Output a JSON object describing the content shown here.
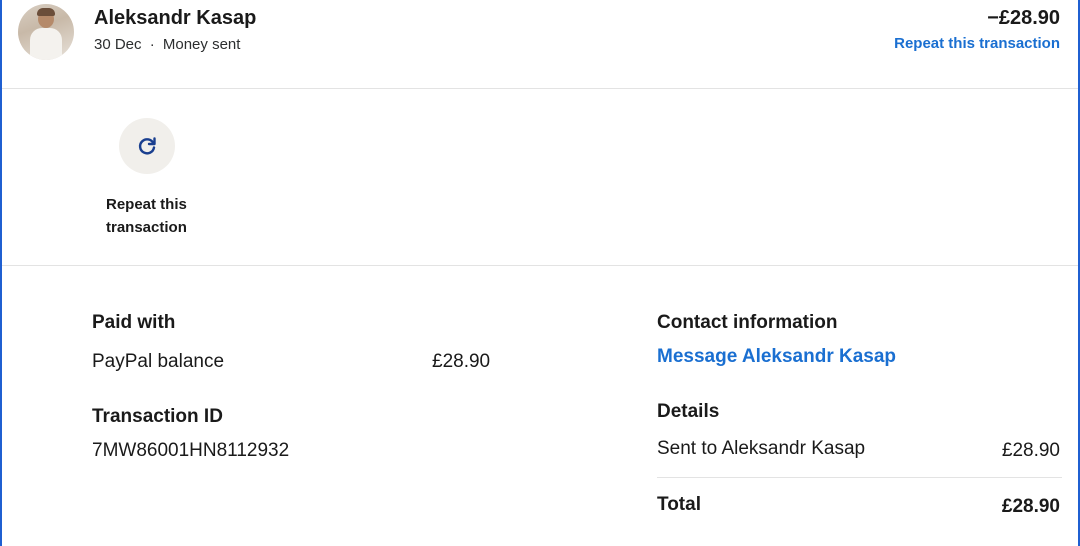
{
  "header": {
    "name": "Aleksandr Kasap",
    "date": "30 Dec",
    "separator": "·",
    "type": "Money sent",
    "amount": "−£28.90",
    "repeat_link": "Repeat this transaction"
  },
  "actions": {
    "repeat": {
      "icon": "refresh-icon",
      "label_line1": "Repeat this",
      "label_line2": "transaction"
    }
  },
  "paid_with": {
    "heading": "Paid with",
    "method": "PayPal balance",
    "amount": "£28.90"
  },
  "transaction": {
    "heading": "Transaction ID",
    "id": "7MW86001HN8112932"
  },
  "contact": {
    "heading": "Contact information",
    "message_link": "Message Aleksandr Kasap"
  },
  "details": {
    "heading": "Details",
    "sent_label": "Sent to Aleksandr Kasap",
    "sent_amount": "£28.90",
    "total_label": "Total",
    "total_amount": "£28.90"
  },
  "colors": {
    "accent": "#1a6fd1",
    "frame_border": "#1f5fd1",
    "action_bg": "#f1efeb"
  }
}
